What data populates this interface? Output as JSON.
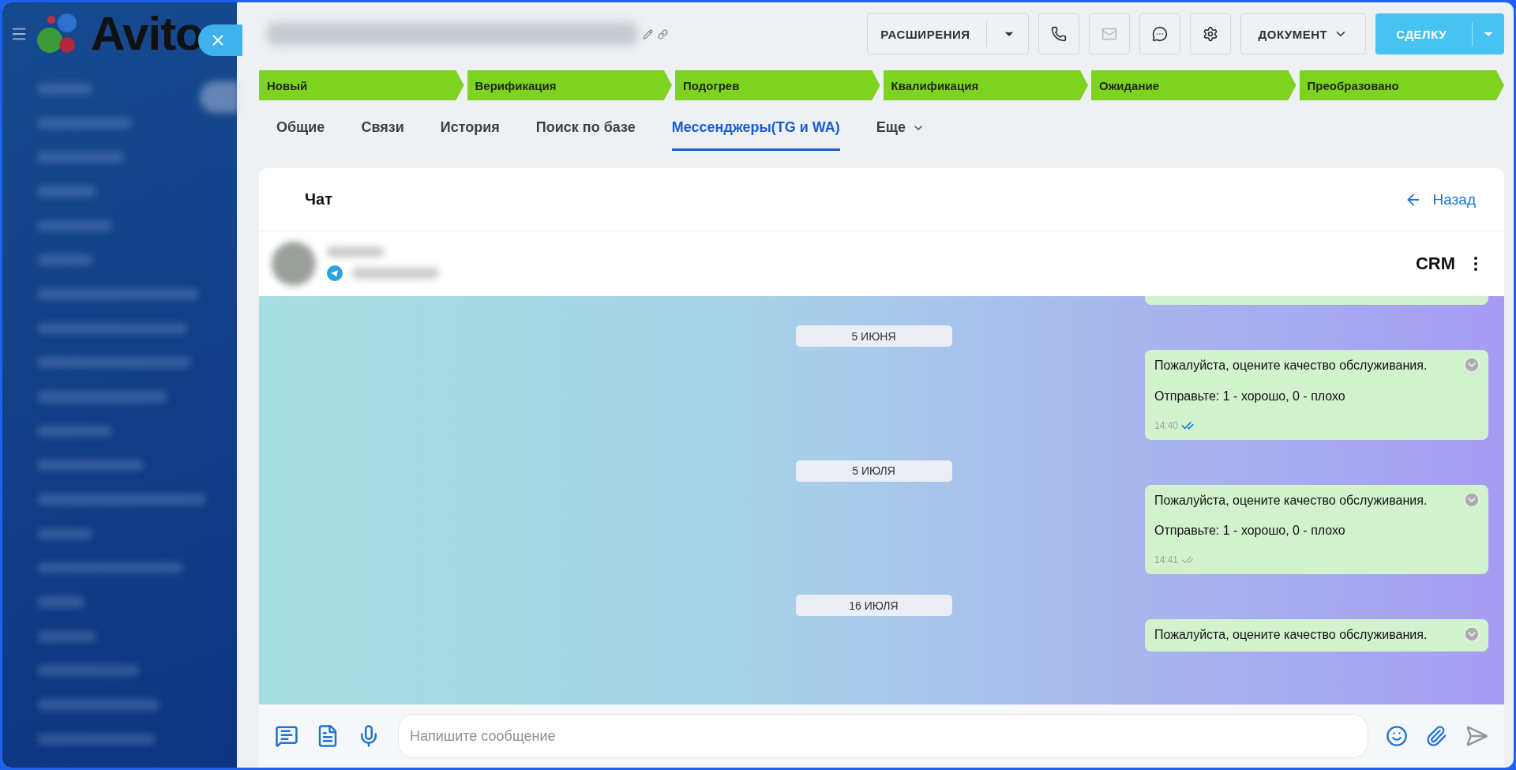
{
  "sidebar": {
    "logo": "Avito"
  },
  "header": {
    "extensions_button": "РАСШИРЕНИЯ",
    "icon_buttons": [
      {
        "kind": "phone",
        "disabled": false
      },
      {
        "kind": "mail",
        "disabled": true
      },
      {
        "kind": "chat",
        "disabled": false
      },
      {
        "kind": "settings",
        "disabled": false
      }
    ],
    "document_button": "ДОКУМЕНТ",
    "deal_button": "СДЕЛКУ"
  },
  "pipeline": [
    "Новый",
    "Верификация",
    "Подогрев",
    "Квалификация",
    "Ожидание",
    "Преобразовано"
  ],
  "tabs": [
    {
      "label": "Общие",
      "selected": false,
      "kind": "tab"
    },
    {
      "label": "Связи",
      "selected": false,
      "kind": "tab"
    },
    {
      "label": "История",
      "selected": false,
      "kind": "tab"
    },
    {
      "label": "Поиск по базе",
      "selected": false,
      "kind": "tab"
    },
    {
      "label": "Мессенджеры(TG и WA)",
      "selected": true,
      "kind": "tab"
    },
    {
      "label": "Еще",
      "selected": false,
      "kind": "menu"
    }
  ],
  "chat": {
    "title": "Чат",
    "back": "Назад",
    "crm": "CRM",
    "items": [
      {
        "kind": "cut"
      },
      {
        "kind": "date",
        "text": "5 ИЮНЯ"
      },
      {
        "kind": "message",
        "lines": [
          "Пожалуйста, оцените качество обслуживания.",
          "Отправьте: 1 - хорошо, 0 - плохо"
        ],
        "time": "14:40",
        "read": true
      },
      {
        "kind": "date",
        "text": "5 ИЮЛЯ"
      },
      {
        "kind": "message",
        "lines": [
          "Пожалуйста, оцените качество обслуживания.",
          "Отправьте: 1 - хорошо, 0 - плохо"
        ],
        "time": "14:41",
        "read": false
      },
      {
        "kind": "date",
        "text": "16 ИЮЛЯ"
      },
      {
        "kind": "message",
        "lines": [
          "Пожалуйста, оцените качество обслуживания."
        ]
      }
    ],
    "input": {
      "placeholder": "Напишите сообщение"
    }
  }
}
